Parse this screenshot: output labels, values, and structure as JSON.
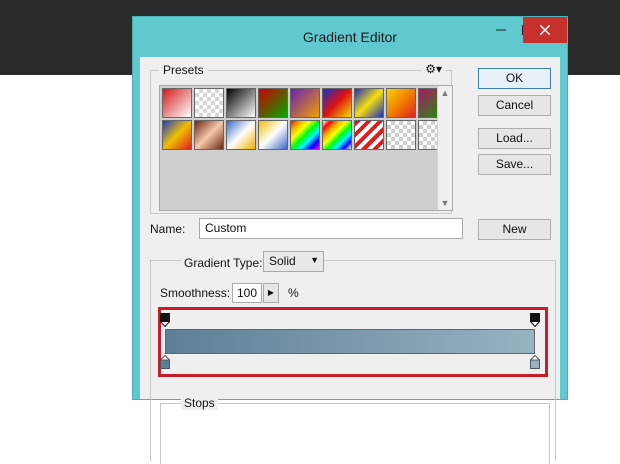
{
  "window": {
    "title": "Gradient Editor"
  },
  "presets": {
    "label": "Presets",
    "swatches": [
      "linear-gradient(135deg,#d41c1c,#ffffff)",
      "repeating-conic-gradient(#d6d6d6 0 25%, #ffffff 0 50%) 0 0/8px 8px",
      "linear-gradient(135deg,#000,#fff)",
      "linear-gradient(135deg,#c00,#0a0)",
      "linear-gradient(135deg,#6a1fb3,#f0a000)",
      "linear-gradient(135deg,#1530c8,#e01010,#f0e000)",
      "linear-gradient(135deg,#1a2fbf,#f6e00d,#1a2fbf)",
      "linear-gradient(135deg,#f8d200,#f08000,#e02020)",
      "linear-gradient(135deg,#b0166a,#0aa000)",
      "linear-gradient(135deg,#1f3cc8,#f0c000,#e02020)",
      "linear-gradient(135deg,#6a2a12,#f5c7a8,#6a2a12)",
      "linear-gradient(135deg,#3a66c8,#fff,#f0b000)",
      "linear-gradient(135deg,#f0c000,#fff,#3a66c8)",
      "linear-gradient(135deg,red,orange,yellow,lime,cyan,blue,magenta)",
      "linear-gradient(135deg,#fff,red,orange,yellow,lime,cyan,blue,#fff)",
      "repeating-linear-gradient(135deg,#e01c1c 0 4px,#fff 4px 8px)",
      "repeating-conic-gradient(#cfcfcf 0 25%, #ffffff 0 50%) 0 0/8px 8px",
      "repeating-conic-gradient(#cfcfcf 0 25%, #ffffff 0 50%) 0 0/8px 8px"
    ]
  },
  "buttons": {
    "ok": "OK",
    "cancel": "Cancel",
    "load": "Load...",
    "save": "Save...",
    "new": "New"
  },
  "name": {
    "label": "Name:",
    "value": "Custom"
  },
  "gradient_type": {
    "label": "Gradient Type:",
    "value": "Solid"
  },
  "smoothness": {
    "label": "Smoothness:",
    "value": "100",
    "unit": "%"
  },
  "gradient": {
    "start_color": "#5d7f96",
    "end_color": "#98b2c2"
  },
  "stops": {
    "label": "Stops"
  },
  "colors": {
    "highlight": "#c71c2a",
    "titlebar": "#5fc9cf"
  }
}
